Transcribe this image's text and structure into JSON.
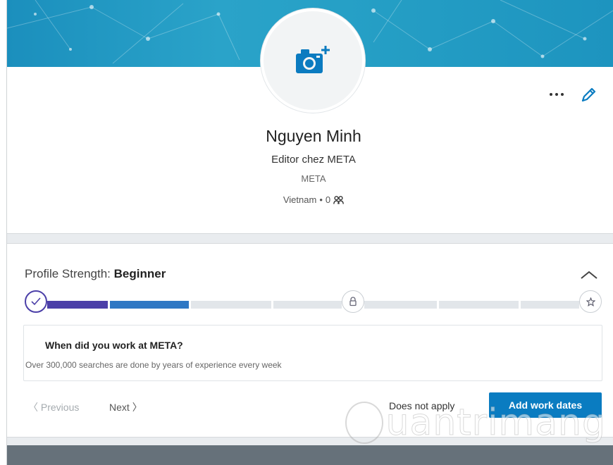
{
  "profile": {
    "name": "Nguyen Minh",
    "headline": "Editor chez META",
    "company": "META",
    "location": "Vietnam",
    "separator": "•",
    "connections": "0",
    "icons": {
      "avatar": "camera-plus-icon",
      "more": "more-horizontal-icon",
      "edit": "pencil-icon",
      "connections": "people-icon"
    }
  },
  "strength": {
    "label": "Profile Strength:",
    "level": "Beginner",
    "progress_segments_filled": 2,
    "progress_segments_total": 7,
    "colors": {
      "filled_start": "#4b3fa8",
      "filled_end": "#2f78c4",
      "empty": "#e2e6ea"
    }
  },
  "question": {
    "title": "When did you work at META?",
    "subtitle": "Over 300,000 searches are done by years of experience every week"
  },
  "nav": {
    "previous": "Previous",
    "next": "Next",
    "does_not_apply": "Does not apply",
    "add": "Add work dates"
  },
  "watermark": {
    "text": "uantrimang"
  },
  "colors": {
    "banner": "#1b8fbd",
    "primary": "#0a7cc1"
  }
}
